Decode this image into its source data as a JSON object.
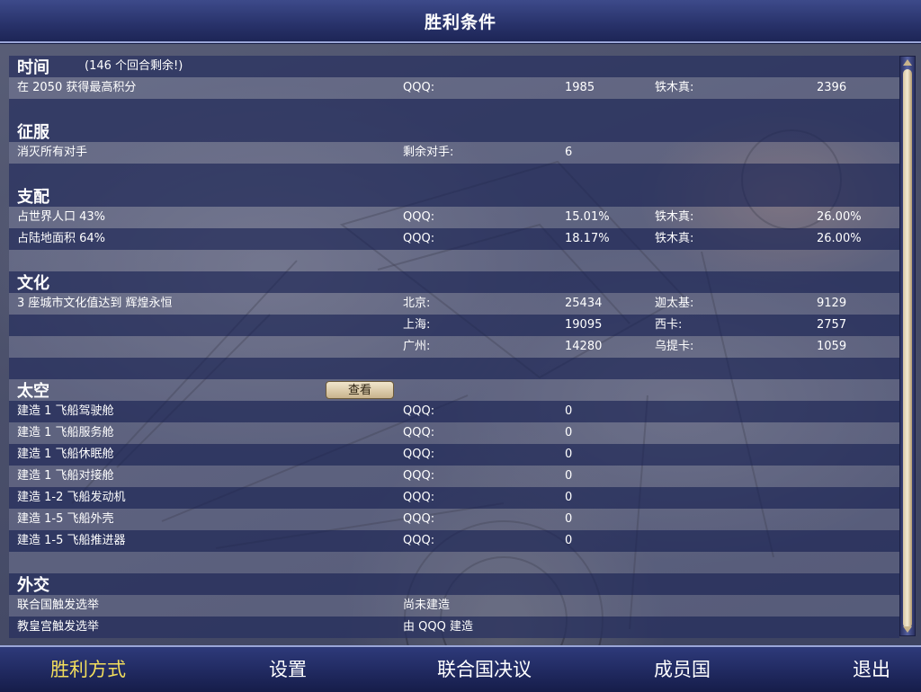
{
  "header": {
    "title": "胜利条件"
  },
  "sections": {
    "time": {
      "title": "时间",
      "subtitle": "(146 个回合剩余!)",
      "row1": {
        "label": "在 2050 获得最高积分",
        "p1": "QQQ:",
        "v1": "1985",
        "p2": "铁木真:",
        "v2": "2396"
      }
    },
    "conquest": {
      "title": "征服",
      "row1": {
        "label": "消灭所有对手",
        "p1": "剩余对手:",
        "v1": "6"
      }
    },
    "domination": {
      "title": "支配",
      "row1": {
        "label": "占世界人口 43%",
        "p1": "QQQ:",
        "v1": "15.01%",
        "p2": "铁木真:",
        "v2": "26.00%"
      },
      "row2": {
        "label": "占陆地面积 64%",
        "p1": "QQQ:",
        "v1": "18.17%",
        "p2": "铁木真:",
        "v2": "26.00%"
      }
    },
    "culture": {
      "title": "文化",
      "row1": {
        "label": "3 座城市文化值达到 辉煌永恒",
        "p1": "北京:",
        "v1": "25434",
        "p2": "迦太基:",
        "v2": "9129"
      },
      "row2": {
        "p1": "上海:",
        "v1": "19095",
        "p2": "西卡:",
        "v2": "2757"
      },
      "row3": {
        "p1": "广州:",
        "v1": "14280",
        "p2": "乌提卡:",
        "v2": "1059"
      }
    },
    "space": {
      "title": "太空",
      "view_button": "查看",
      "rows": [
        {
          "label": "建造 1 飞船驾驶舱",
          "p1": "QQQ:",
          "v1": "0"
        },
        {
          "label": "建造 1 飞船服务舱",
          "p1": "QQQ:",
          "v1": "0"
        },
        {
          "label": "建造 1 飞船休眠舱",
          "p1": "QQQ:",
          "v1": "0"
        },
        {
          "label": "建造 1 飞船对接舱",
          "p1": "QQQ:",
          "v1": "0"
        },
        {
          "label": "建造 1-2 飞船发动机",
          "p1": "QQQ:",
          "v1": "0"
        },
        {
          "label": "建造 1-5 飞船外壳",
          "p1": "QQQ:",
          "v1": "0"
        },
        {
          "label": "建造 1-5 飞船推进器",
          "p1": "QQQ:",
          "v1": "0"
        }
      ]
    },
    "diplomacy": {
      "title": "外交",
      "row1": {
        "label": "联合国触发选举",
        "p1": "尚未建造"
      },
      "row2": {
        "label": "教皇宫触发选举",
        "p1": "由 QQQ 建造"
      }
    }
  },
  "nav": {
    "victory": "胜利方式",
    "settings": "设置",
    "un_resolutions": "联合国决议",
    "members": "成员国",
    "exit": "退出"
  },
  "colors": {
    "active_nav": "#f3de5c",
    "header_bg": "#28326a",
    "row_dark": "#283060"
  }
}
